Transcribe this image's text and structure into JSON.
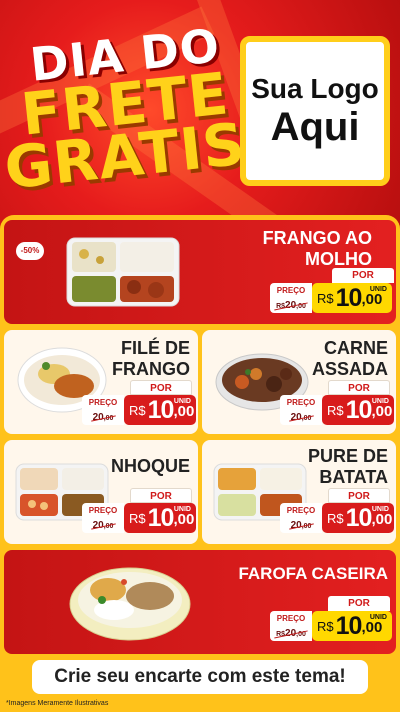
{
  "header": {
    "title_line1": "DIA DO",
    "title_line2": "FRETE",
    "title_line3": "GRATIS",
    "logo_line1": "Sua Logo",
    "logo_line2": "Aqui"
  },
  "badge": "-50%",
  "products": [
    {
      "name1": "FRANGO AO",
      "name2": "MOLHO",
      "por": "POR",
      "preco_label": "PREÇO",
      "old_int": "20",
      "old_dec": ",00",
      "currency": "R$",
      "int": "10",
      "dec": ",00",
      "unid": "UNID"
    },
    {
      "name1": "FILÉ DE",
      "name2": "FRANGO",
      "por": "POR",
      "preco_label": "PREÇO",
      "old_int": "20",
      "old_dec": ",00",
      "currency": "R$",
      "int": "10",
      "dec": ",00",
      "unid": "UNID"
    },
    {
      "name1": "CARNE",
      "name2": "ASSADA",
      "por": "POR",
      "preco_label": "PREÇO",
      "old_int": "20",
      "old_dec": ",00",
      "currency": "R$",
      "int": "10",
      "dec": ",00",
      "unid": "UNID"
    },
    {
      "name1": "NHOQUE",
      "name2": "",
      "por": "POR",
      "preco_label": "PREÇO",
      "old_int": "20",
      "old_dec": ",00",
      "currency": "R$",
      "int": "10",
      "dec": ",00",
      "unid": "UNID"
    },
    {
      "name1": "PURE DE",
      "name2": "BATATA",
      "por": "POR",
      "preco_label": "PREÇO",
      "old_int": "20",
      "old_dec": ",00",
      "currency": "R$",
      "int": "10",
      "dec": ",00",
      "unid": "UNID"
    },
    {
      "name1": "FAROFA CASEIRA",
      "name2": "",
      "por": "POR",
      "preco_label": "PREÇO",
      "old_int": "20",
      "old_dec": ",00",
      "currency": "R$",
      "int": "10",
      "dec": ",00",
      "unid": "UNID"
    }
  ],
  "cta": "Crie seu encarte com este tema!",
  "footer_note": "*Imagens Meramente Ilustrativas",
  "colors": {
    "red": "#d81b1b",
    "yellow": "#ffd800",
    "gold": "#ffc21a"
  }
}
